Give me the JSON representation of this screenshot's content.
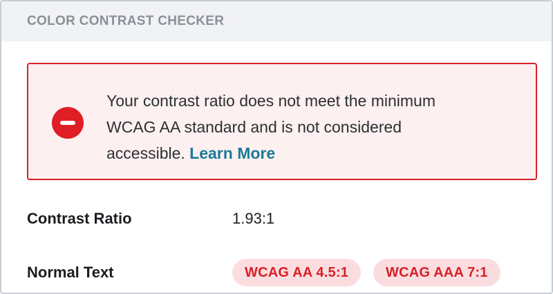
{
  "header": {
    "title": "COLOR CONTRAST CHECKER"
  },
  "alert": {
    "icon": "minus-circle-icon",
    "message": " Your contrast ratio does not meet the minimum WCAG AA standard and is not considered accessible. ",
    "link_label": "Learn More",
    "border_color": "#d81f26",
    "background_color": "#fdf0f0"
  },
  "contrast": {
    "label": "Contrast Ratio",
    "value": "1.93:1"
  },
  "normal_text": {
    "label": "Normal Text",
    "badges": [
      {
        "label": "WCAG AA 4.5:1",
        "status": "fail"
      },
      {
        "label": "WCAG AAA 7:1",
        "status": "fail"
      }
    ]
  },
  "colors": {
    "fail_text": "#d81f26",
    "fail_badge_bg": "#fbdde0",
    "link": "#1a7a98"
  }
}
